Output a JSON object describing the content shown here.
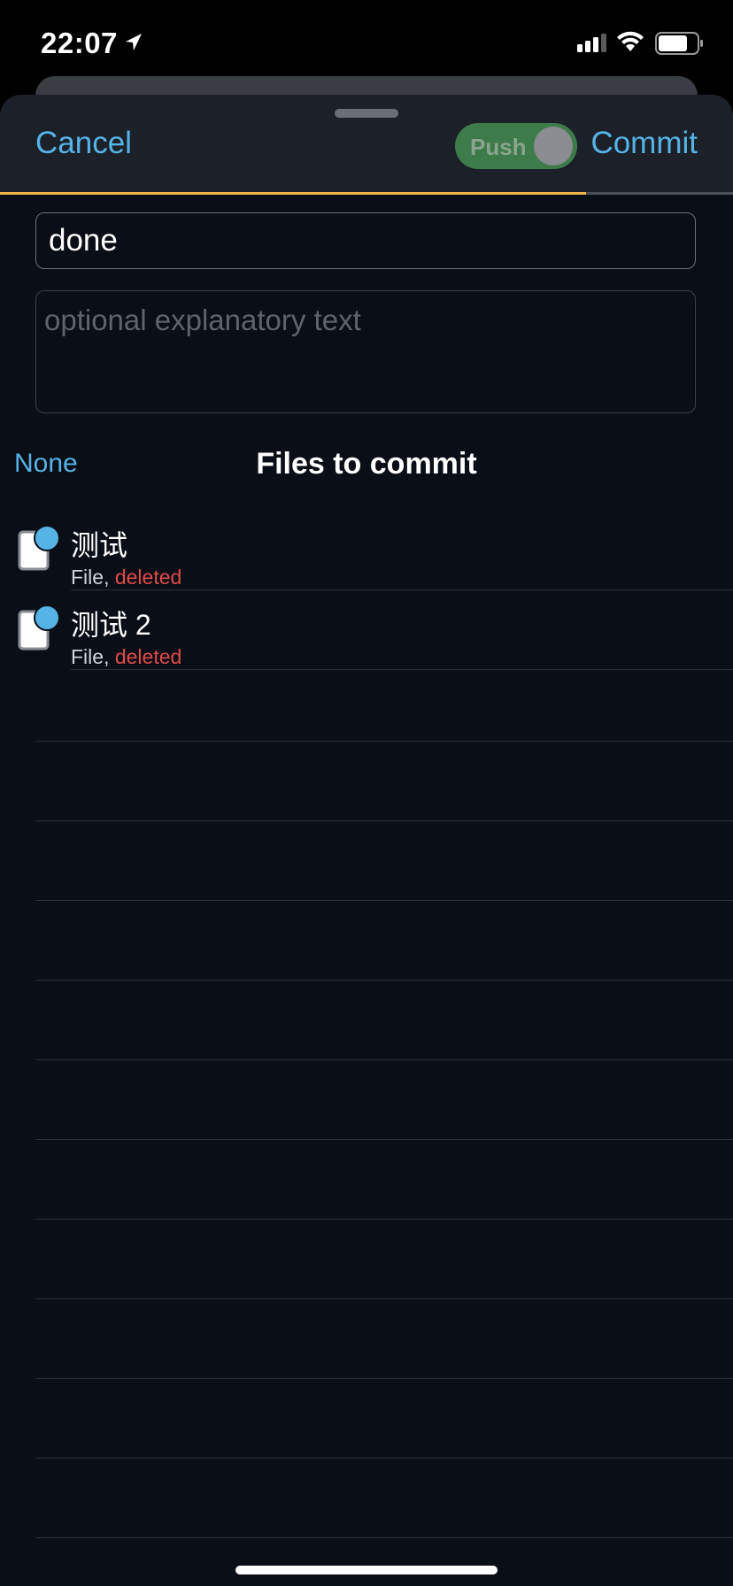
{
  "status_bar": {
    "time": "22:07",
    "location_icon": "location-arrow-icon",
    "signal_icon": "cellular-signal-icon",
    "wifi_icon": "wifi-icon",
    "battery_icon": "battery-icon"
  },
  "header": {
    "cancel_label": "Cancel",
    "push_label": "Push",
    "commit_label": "Commit",
    "progress": 0.8
  },
  "commit_form": {
    "summary_value": "done",
    "description_placeholder": "optional explanatory text"
  },
  "files_section": {
    "select_none_label": "None",
    "title": "Files to commit",
    "files": [
      {
        "name": "测试",
        "type": "File",
        "separator": ", ",
        "status": "deleted"
      },
      {
        "name": "测试 2",
        "type": "File",
        "separator": ", ",
        "status": "deleted"
      }
    ]
  },
  "colors": {
    "accent": "#56b3e6",
    "deleted": "#e24a4a",
    "progress": "#f0b64b",
    "toggle": "#3e7b4a"
  }
}
